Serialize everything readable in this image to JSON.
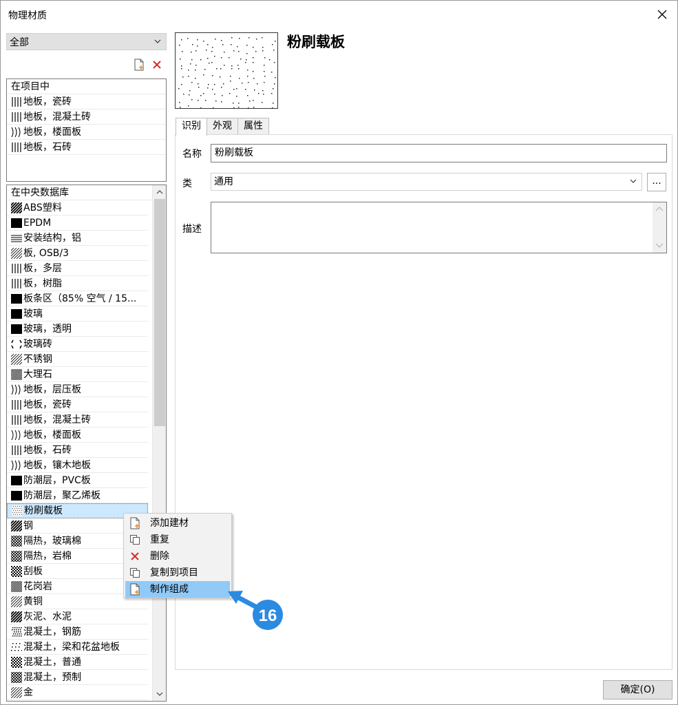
{
  "window": {
    "title": "物理材质"
  },
  "filter": {
    "selected": "全部"
  },
  "project_list": {
    "header": "在项目中",
    "items": [
      {
        "label": "地板，瓷砖",
        "swatch": "vertical-lines"
      },
      {
        "label": "地板，混凝土砖",
        "swatch": "vertical-lines"
      },
      {
        "label": "地板，楼面板",
        "swatch": "wavy-lines"
      },
      {
        "label": "地板，石砖",
        "swatch": "vertical-lines"
      }
    ]
  },
  "library_list": {
    "header": "在中央数据库",
    "items": [
      {
        "label": "ABS塑料",
        "swatch": "diagonal-bold"
      },
      {
        "label": "EPDM",
        "swatch": "solid"
      },
      {
        "label": "安装结构，铝",
        "swatch": "horizontal-lines"
      },
      {
        "label": "板, OSB/3",
        "swatch": "diagonal-thin"
      },
      {
        "label": "板，多层",
        "swatch": "vertical-lines"
      },
      {
        "label": "板，树脂",
        "swatch": "vertical-lines"
      },
      {
        "label": "板条区（85% 空气 / 15...",
        "swatch": "solid"
      },
      {
        "label": "玻璃",
        "swatch": "solid"
      },
      {
        "label": "玻璃，透明",
        "swatch": "solid"
      },
      {
        "label": "玻璃砖",
        "swatch": "dashed-brackets"
      },
      {
        "label": "不锈钢",
        "swatch": "diagonal-thin"
      },
      {
        "label": "大理石",
        "swatch": "diagonal-dense"
      },
      {
        "label": "地板，层压板",
        "swatch": "wavy-lines"
      },
      {
        "label": "地板，瓷砖",
        "swatch": "vertical-lines"
      },
      {
        "label": "地板，混凝土砖",
        "swatch": "vertical-lines"
      },
      {
        "label": "地板，楼面板",
        "swatch": "wavy-lines"
      },
      {
        "label": "地板，石砖",
        "swatch": "vertical-lines"
      },
      {
        "label": "地板，镶木地板",
        "swatch": "wavy-lines"
      },
      {
        "label": "防潮层，PVC板",
        "swatch": "solid"
      },
      {
        "label": "防潮层，聚乙烯板",
        "swatch": "solid"
      },
      {
        "label": "粉刷载板",
        "swatch": "dots",
        "selected": true
      },
      {
        "label": "钢",
        "swatch": "diagonal-bold"
      },
      {
        "label": "隔热，玻璃棉",
        "swatch": "crosshatch"
      },
      {
        "label": "隔热，岩棉",
        "swatch": "crosshatch"
      },
      {
        "label": "刮板",
        "swatch": "checker"
      },
      {
        "label": "花岗岩",
        "swatch": "diagonal-dense"
      },
      {
        "label": "黄铜",
        "swatch": "diagonal-thin"
      },
      {
        "label": "灰泥、水泥",
        "swatch": "diagonal-bold"
      },
      {
        "label": "混凝土，钢筋",
        "swatch": "speckle"
      },
      {
        "label": "混凝土，梁和花盆地板",
        "swatch": "speckle-light"
      },
      {
        "label": "混凝土，普通",
        "swatch": "checker"
      },
      {
        "label": "混凝土，预制",
        "swatch": "crosshatch"
      },
      {
        "label": "金",
        "swatch": "diagonal-thin"
      }
    ]
  },
  "detail": {
    "title": "粉刷载板",
    "tabs": [
      {
        "label": "识别",
        "active": true
      },
      {
        "label": "外观",
        "active": false
      },
      {
        "label": "属性",
        "active": false
      }
    ],
    "name_label": "名称",
    "name_value": "粉刷载板",
    "class_label": "类",
    "class_value": "通用",
    "ellipsis_label": "...",
    "desc_label": "描述",
    "desc_value": ""
  },
  "context_menu": {
    "items": [
      {
        "label": "添加建材",
        "icon": "new-document-icon"
      },
      {
        "label": "重复",
        "icon": "copy-icon"
      },
      {
        "label": "删除",
        "icon": "delete-icon"
      },
      {
        "label": "复制到项目",
        "icon": "copy-icon"
      },
      {
        "label": "制作组成",
        "icon": "new-document-icon",
        "highlight": true
      }
    ]
  },
  "ok_button": "确定(O)",
  "callout": {
    "number": "16",
    "color": "#2b8ae2"
  }
}
